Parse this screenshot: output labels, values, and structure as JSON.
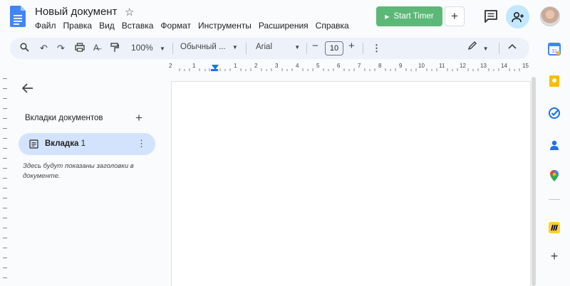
{
  "header": {
    "title": "Новый документ",
    "menu": [
      "Файл",
      "Правка",
      "Вид",
      "Вставка",
      "Формат",
      "Инструменты",
      "Расширения",
      "Справка"
    ],
    "start_timer": "Start Timer"
  },
  "toolbar": {
    "zoom": "100%",
    "style": "Обычный ...",
    "font": "Arial",
    "font_size": "10"
  },
  "ruler": {
    "labels": [
      "2",
      "1",
      "1",
      "2",
      "3",
      "4",
      "5",
      "6",
      "7",
      "8",
      "9",
      "10",
      "11",
      "12",
      "13",
      "14",
      "15"
    ]
  },
  "sidebar": {
    "title": "Вкладки документов",
    "tab_label": "Вкладка",
    "tab_number": "1",
    "hint": "Здесь будут показаны заголовки в документе."
  },
  "colors": {
    "accent": "#1a73e8",
    "timer_green": "#5cb877",
    "tab_selected": "#d3e3fd",
    "toolbar_bg": "#edf2fa"
  }
}
